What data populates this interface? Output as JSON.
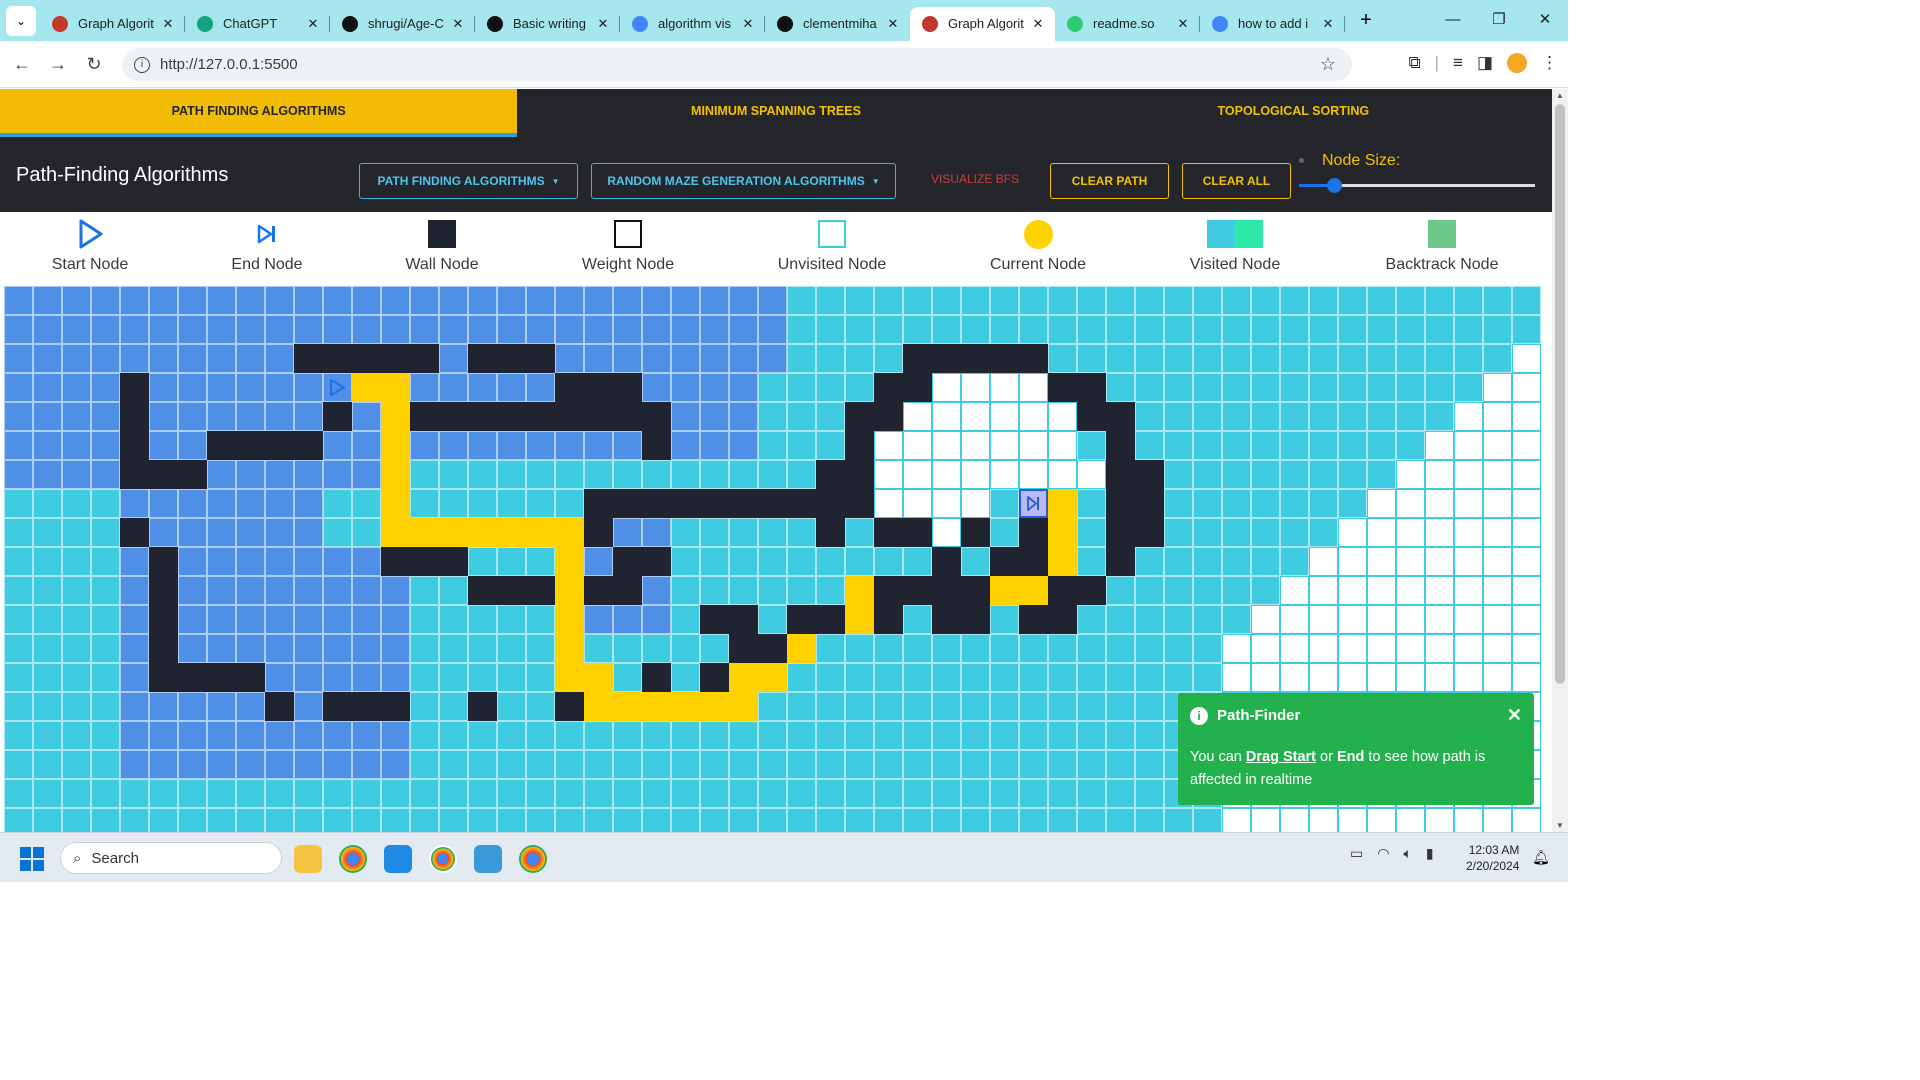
{
  "browser": {
    "tabs": [
      {
        "title": "Graph Algorit",
        "icon": "react-icon",
        "color": "#c0392b"
      },
      {
        "title": "ChatGPT",
        "icon": "chatgpt-icon",
        "color": "#10a37f"
      },
      {
        "title": "shrugi/Age-C",
        "icon": "github-icon",
        "color": "#111111"
      },
      {
        "title": "Basic writing",
        "icon": "github-icon",
        "color": "#111111"
      },
      {
        "title": "algorithm vis",
        "icon": "google-icon",
        "color": "#4285f4"
      },
      {
        "title": "clementmiha",
        "icon": "github-icon",
        "color": "#111111"
      },
      {
        "title": "Graph Algorit",
        "icon": "react-icon",
        "color": "#c0392b"
      },
      {
        "title": "readme.so",
        "icon": "readme-icon",
        "color": "#2ecc71"
      },
      {
        "title": "how to add i",
        "icon": "google-icon",
        "color": "#4285f4"
      }
    ],
    "active_tab": 6,
    "url": "http://127.0.0.1:5500"
  },
  "nav": {
    "tabs": [
      "PATH FINDING ALGORITHMS",
      "MINIMUM SPANNING TREES",
      "TOPOLOGICAL SORTING"
    ],
    "active": 0
  },
  "toolbar": {
    "title": "Path-Finding Algorithms",
    "algo_dropdown": "PATH FINDING ALGORITHMS",
    "maze_dropdown": "RANDOM MAZE GENERATION ALGORITHMS",
    "visualize": "VISUALIZE BFS",
    "clear_path": "CLEAR PATH",
    "clear_all": "CLEAR ALL",
    "node_size_label": "Node Size:",
    "node_size_value": 0.15
  },
  "legend": [
    {
      "label": "Start Node",
      "icon": "play-icon"
    },
    {
      "label": "End Node",
      "icon": "skip-icon"
    },
    {
      "label": "Wall Node",
      "icon": "wall-icon"
    },
    {
      "label": "Weight Node",
      "icon": "weight-icon"
    },
    {
      "label": "Unvisited Node",
      "icon": "unvisited-icon"
    },
    {
      "label": "Current Node",
      "icon": "current-icon"
    },
    {
      "label": "Visited Node",
      "icon": "visited-icon"
    },
    {
      "label": "Backtrack Node",
      "icon": "backtrack-icon"
    }
  ],
  "colors": {
    "visited": "#40cce0",
    "visited_old": "#4f8fe6",
    "unvisited": "#ffffff",
    "wall": "#1f2430",
    "path": "#ffd200",
    "current": "#ffd200",
    "backtrack": "#6cc788",
    "toast": "#22b14c",
    "accent": "#f2bc05"
  },
  "grid": {
    "walls": [
      "2,10",
      "2,11",
      "2,12",
      "2,13",
      "2,14",
      "2,16",
      "2,17",
      "2,18",
      "3,4",
      "3,19",
      "3,20",
      "3,21",
      "4,4",
      "4,11",
      "4,14",
      "4,15",
      "4,16",
      "4,17",
      "4,18",
      "4,19",
      "4,20",
      "4,21",
      "4,22",
      "5,4",
      "5,7",
      "5,8",
      "5,9",
      "5,10",
      "5,22",
      "6,4",
      "6,5",
      "6,6",
      "6,28",
      "6,29",
      "7,20",
      "7,21",
      "7,22",
      "7,23",
      "7,24",
      "7,25",
      "7,26",
      "7,27",
      "7,28",
      "7,29",
      "8,4",
      "8,20",
      "8,28",
      "9,5",
      "9,13",
      "9,14",
      "9,15",
      "9,21",
      "9,22",
      "10,5",
      "10,16",
      "10,17",
      "10,18",
      "10,20",
      "10,21",
      "11,5",
      "11,24",
      "11,25",
      "11,27",
      "11,28",
      "12,5",
      "12,25",
      "12,26",
      "13,5",
      "13,6",
      "13,7",
      "13,8",
      "13,22",
      "13,24",
      "14,9",
      "14,11",
      "14,12",
      "14,13",
      "14,16",
      "14,19",
      "2,31",
      "2,32",
      "2,33",
      "2,34",
      "2,35",
      "3,30",
      "3,31",
      "3,36",
      "3,37",
      "4,29",
      "4,30",
      "4,37",
      "4,38",
      "5,29",
      "5,38",
      "6,38",
      "6,39",
      "7,38",
      "7,39",
      "8,30",
      "8,31",
      "8,33",
      "8,35",
      "8,38",
      "8,39",
      "9,32",
      "9,34",
      "9,35",
      "9,38",
      "10,30",
      "10,31",
      "10,32",
      "10,33",
      "10,36",
      "10,37",
      "11,30",
      "11,32",
      "11,33",
      "11,35",
      "11,36"
    ],
    "path": [
      "3,12",
      "3,13",
      "4,13",
      "5,13",
      "6,13",
      "7,13",
      "8,13",
      "8,14",
      "8,15",
      "8,16",
      "8,17",
      "8,18",
      "8,19",
      "9,19",
      "10,19",
      "11,19",
      "12,19",
      "13,19",
      "13,20",
      "14,20",
      "14,21",
      "14,22",
      "14,23",
      "14,24",
      "14,25",
      "13,25",
      "13,26",
      "12,26",
      "12,27",
      "11,27",
      "11,28",
      "11,29",
      "10,29",
      "10,30",
      "10,31",
      "10,32",
      "10,33",
      "10,34",
      "10,35",
      "10,36",
      "9,36",
      "8,36",
      "7,36"
    ],
    "start": "3,11",
    "end": "7,35"
  },
  "toast": {
    "title": "Path-Finder",
    "pre": "You can ",
    "drag_start": "Drag Start",
    "or": " or ",
    "end": "End",
    "post": " to see how path is affected in realtime"
  },
  "taskbar": {
    "search": "Search",
    "time": "12:03 AM",
    "date": "2/20/2024"
  }
}
